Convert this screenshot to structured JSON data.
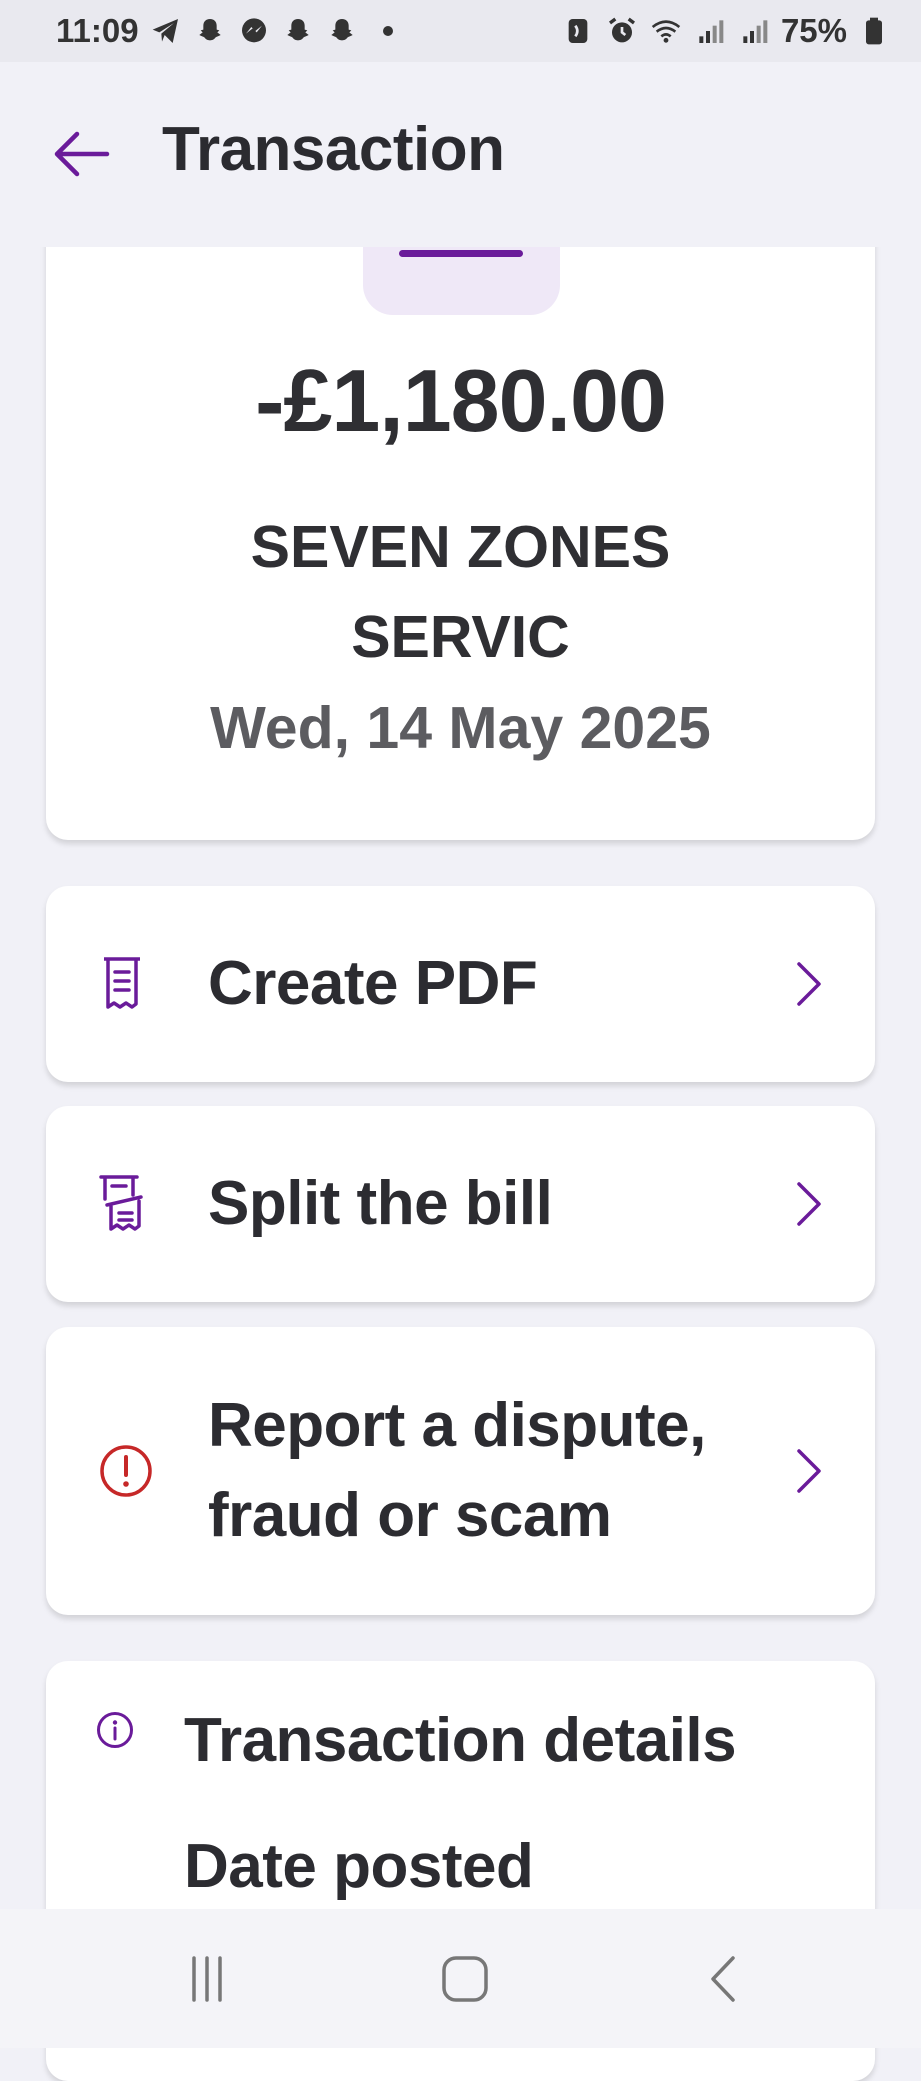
{
  "status_bar": {
    "time": "11:09",
    "battery": "75%"
  },
  "header": {
    "title": "Transaction"
  },
  "summary": {
    "amount": "-£1,180.00",
    "merchant": "SEVEN ZONES SERVIC",
    "date": "Wed, 14 May 2025"
  },
  "actions": [
    {
      "label": "Create PDF",
      "icon": "receipt-icon"
    },
    {
      "label": "Split the bill",
      "icon": "split-bill-icon"
    },
    {
      "label": "Report a dispute, fraud or scam",
      "icon": "alert-icon"
    }
  ],
  "details": {
    "title": "Transaction details",
    "first_label": "Date posted"
  },
  "colors": {
    "accent": "#6a1b9a",
    "alert": "#c62828",
    "background": "#f1f1f7"
  }
}
